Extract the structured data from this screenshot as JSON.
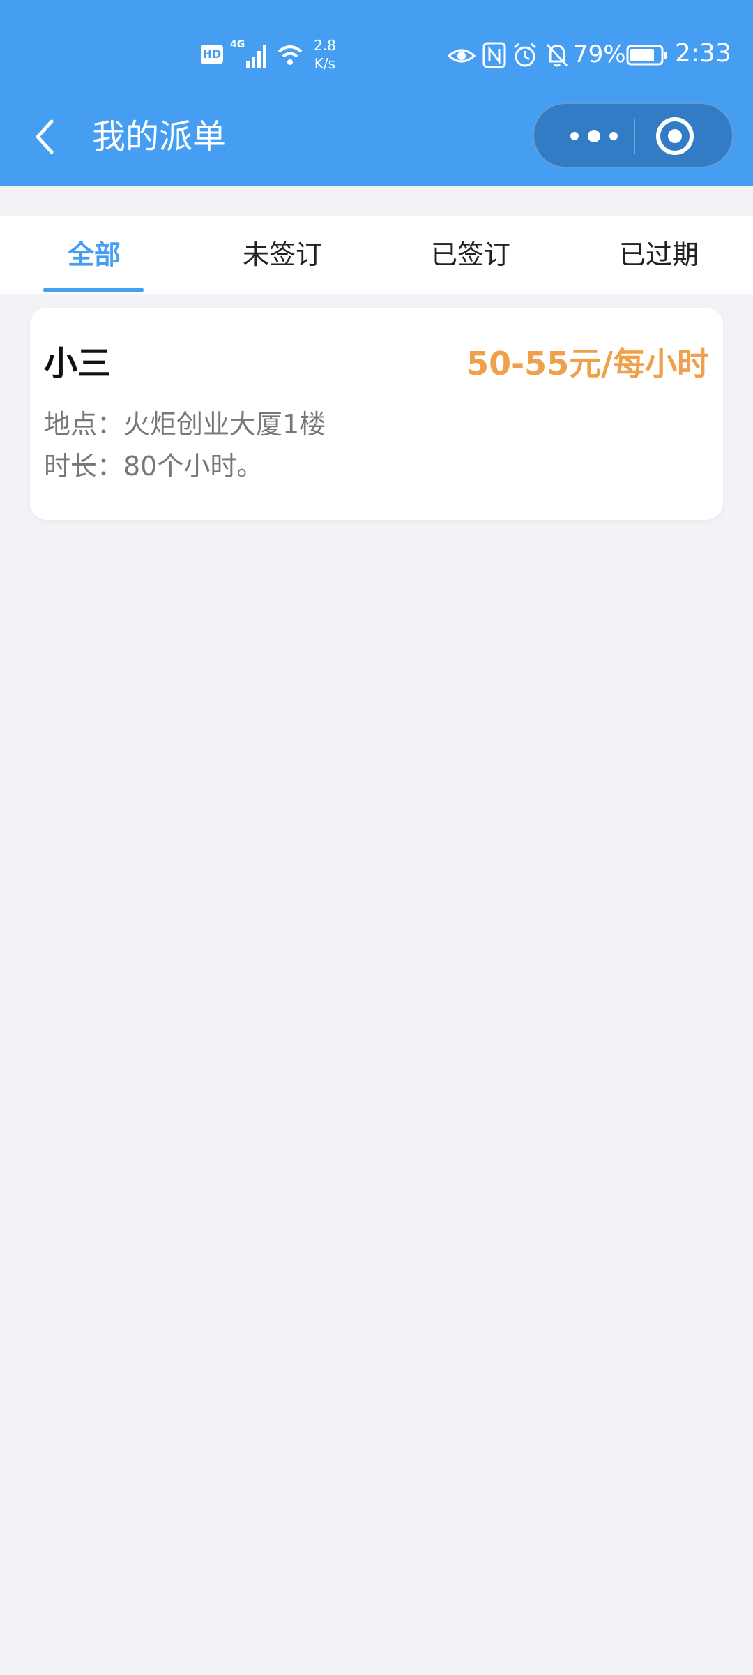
{
  "status_bar": {
    "hd": "HD",
    "network": "4G",
    "speed_value": "2.8",
    "speed_unit": "K/s",
    "battery": "79%",
    "time": "2:33"
  },
  "header": {
    "title": "我的派单",
    "back_icon": "chevron-left-icon",
    "more_icon": "more-dots-icon",
    "close_icon": "target-close-icon",
    "background": "#469ef2"
  },
  "tabs": [
    {
      "label": "全部",
      "active": true
    },
    {
      "label": "未签订",
      "active": false
    },
    {
      "label": "已签订",
      "active": false
    },
    {
      "label": "已过期",
      "active": false
    }
  ],
  "orders": [
    {
      "name": "小三",
      "price": "50-55元/每小时",
      "location": "地点：火炬创业大厦1楼",
      "duration": "时长：80个小时。"
    }
  ],
  "colors": {
    "accent": "#469ef2",
    "price": "#f0a04b",
    "background": "#f2f3f7"
  }
}
